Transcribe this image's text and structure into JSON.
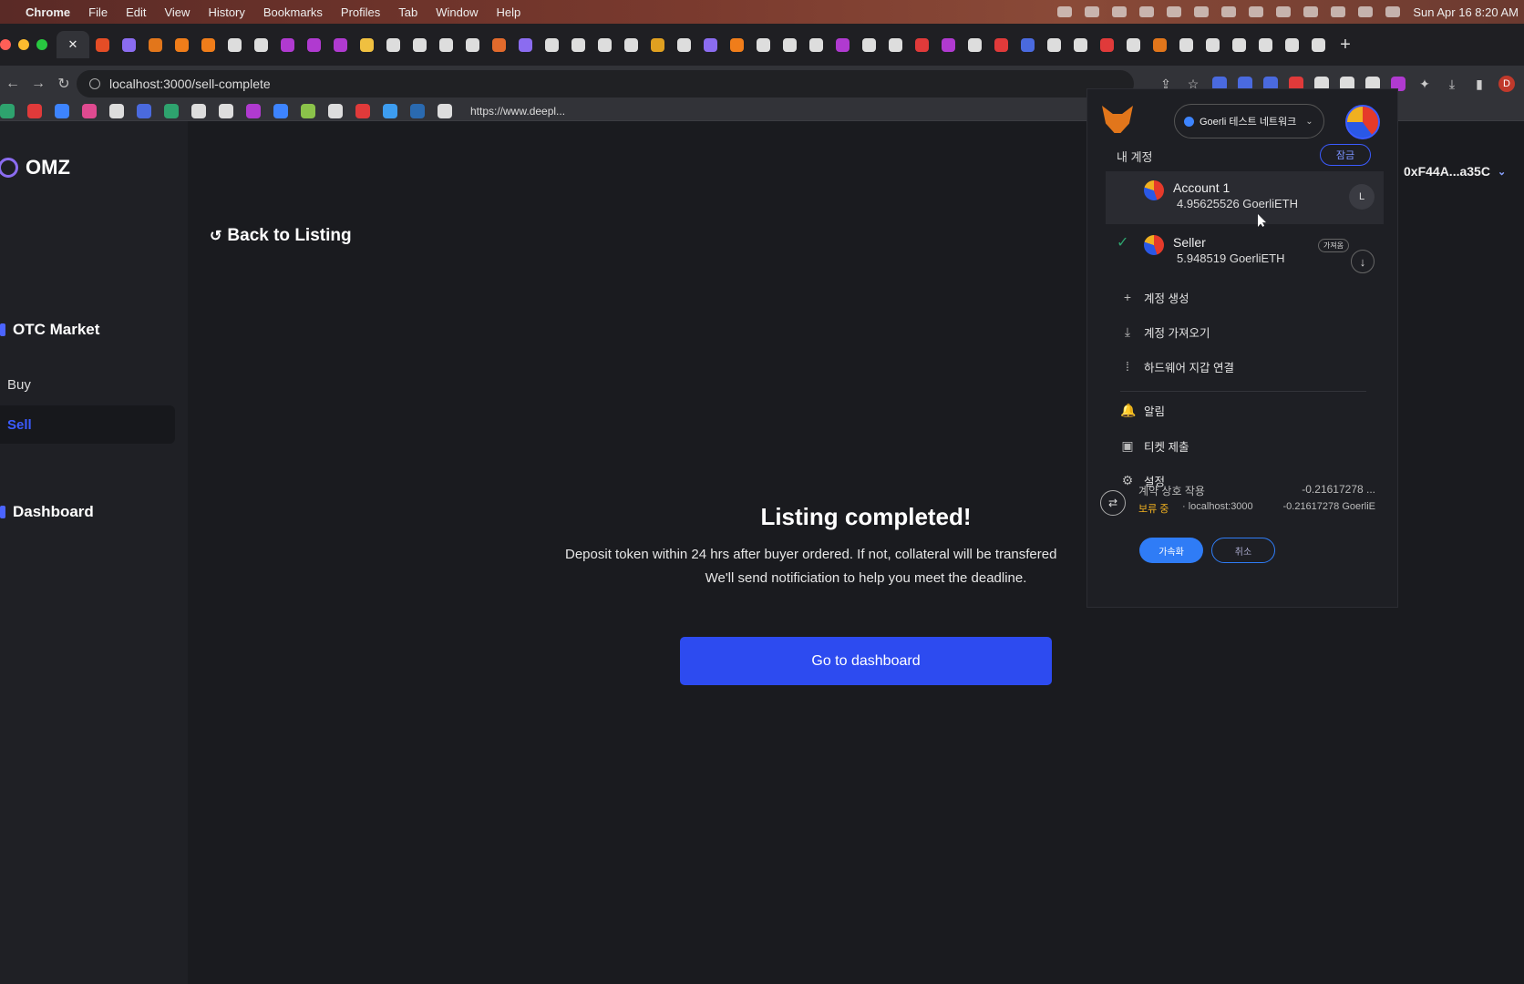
{
  "menubar": {
    "app": "Chrome",
    "items": [
      "File",
      "Edit",
      "View",
      "History",
      "Bookmarks",
      "Profiles",
      "Tab",
      "Window",
      "Help"
    ],
    "clock": "Sun Apr 16  8:20 AM"
  },
  "tabs": {
    "active_close_glyph": "✕",
    "favicon_colors": [
      "#e44d26",
      "#8b6cf0",
      "#e2761b",
      "#f07d1a",
      "#f07d1a",
      "#dddddd",
      "#dddddd",
      "#b03ad0",
      "#b03ad0",
      "#b03ad0",
      "#f0c040",
      "#dddddd",
      "#dddddd",
      "#dddddd",
      "#dddddd",
      "#e26a2c",
      "#8b6cf0",
      "#dddddd",
      "#dddddd",
      "#dddddd",
      "#dddddd",
      "#e0a020",
      "#dddddd",
      "#8b6cf0",
      "#f07d1a",
      "#dddddd",
      "#dddddd",
      "#dddddd",
      "#b03ad0",
      "#dddddd",
      "#dddddd",
      "#e03a3a",
      "#b03ad0",
      "#dddddd",
      "#e03a3a",
      "#4a6adf",
      "#dddddd",
      "#dddddd",
      "#e03a3a",
      "#dddddd",
      "#e2761b",
      "#dddddd",
      "#dddddd",
      "#dddddd",
      "#dddddd",
      "#dddddd",
      "#dddddd"
    ],
    "new_tab": "+"
  },
  "toolbar": {
    "url": "localhost:3000/sell-complete",
    "back": "←",
    "forward": "→",
    "reload": "↻",
    "share": "⇪",
    "star": "☆",
    "puzzle": "✦",
    "download": "⤓",
    "sidepanel": "▮",
    "profile": "D",
    "ext_colors": [
      "#4a6adf",
      "#4a6adf",
      "#4a6adf",
      "#e03a3a",
      "#dddddd",
      "#dddddd",
      "#dddddd",
      "#b03ad0"
    ]
  },
  "bookmarks": {
    "icon_colors": [
      "#2ea36e",
      "#e03a3a",
      "#3d84ff",
      "#e04a90",
      "#dddddd",
      "#4a6adf",
      "#2ea36e",
      "#dddddd",
      "#dddddd",
      "#b03ad0",
      "#3d84ff",
      "#8bc34a",
      "#dddddd",
      "#e03a3a",
      "#3d9df0",
      "#2a6ab0",
      "#dddddd"
    ],
    "text_item": "https://www.deepl..."
  },
  "sidebar": {
    "logo": "OMZ",
    "section": "OTC Market",
    "buy": "Buy",
    "sell": "Sell",
    "dashboard": "Dashboard"
  },
  "main": {
    "back_icon": "↺",
    "back_label": "Back to Listing",
    "headline": "Listing completed!",
    "line1": "Deposit token within 24 hrs after buyer ordered. If not, collateral will be transfered",
    "line2": "We'll send notificiation to help you meet the deadline.",
    "cta": "Go to dashboard",
    "address": "0xF44A...a35C",
    "address_chevron": "⌄"
  },
  "metamask": {
    "network": "Goerli 테스트 네트워크",
    "network_caret": "⌄",
    "title": "내 계정",
    "lock": "잠금",
    "accounts": [
      {
        "name": "Account 1",
        "balance": "4.95625526 GoerliETH",
        "key": "L"
      },
      {
        "name": "Seller",
        "balance": "5.948519 GoerliETH",
        "badge": "가져옴",
        "check": "✓",
        "action": "↓"
      }
    ],
    "menu": [
      {
        "icon": "+",
        "label": "계정 생성"
      },
      {
        "icon": "⤓",
        "label": "계정 가져오기"
      },
      {
        "icon": "⁞",
        "label": "하드웨어 지갑 연결"
      },
      {
        "icon": "🔔",
        "label": "알림"
      },
      {
        "icon": "▣",
        "label": "티켓 제출"
      },
      {
        "icon": "⚙",
        "label": "설정"
      }
    ],
    "activity": {
      "icon": "⇄",
      "title": "계약 상호 작용",
      "status": "보류 중",
      "origin": "· localhost:3000",
      "amount": "-0.21617278 ...",
      "amount2": "-0.21617278 GoerliE",
      "speed_up": "가속화",
      "cancel": "취소"
    }
  }
}
